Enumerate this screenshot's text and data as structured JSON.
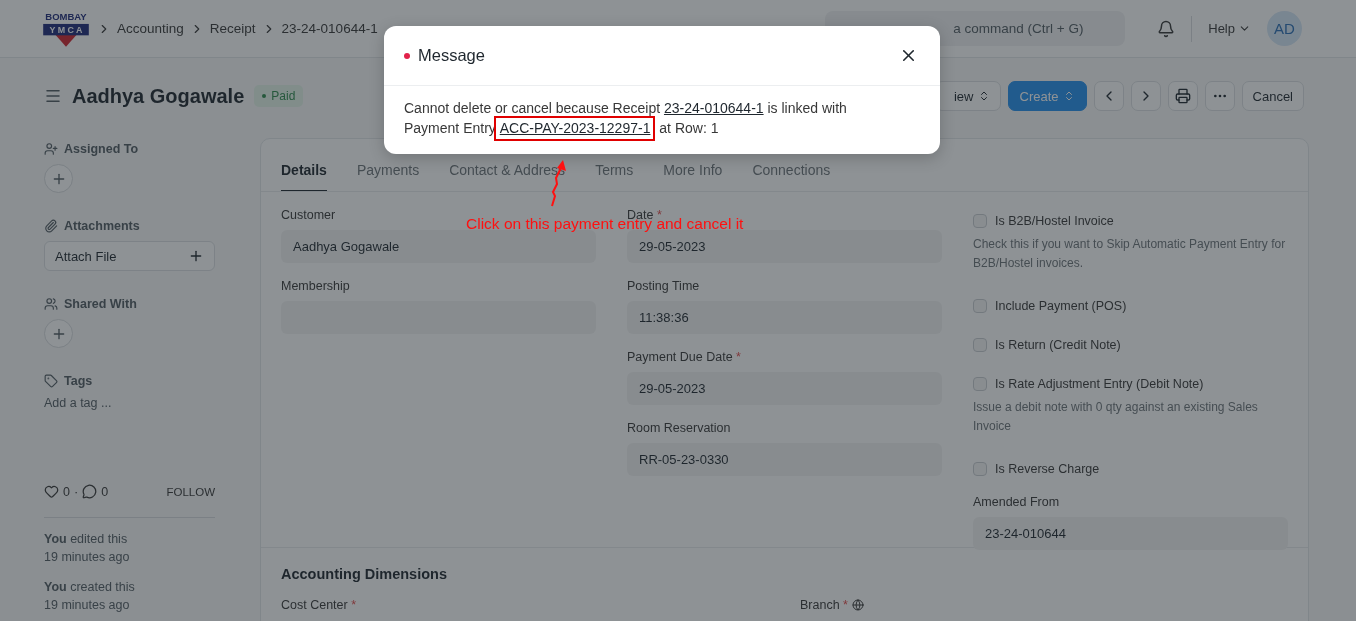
{
  "navbar": {
    "logo": {
      "top": "BOMBAY",
      "band": "Y M C A"
    },
    "breadcrumbs": [
      "Accounting",
      "Receipt",
      "23-24-010644-1"
    ],
    "search": {
      "placeholder": "a command (Ctrl + G)"
    },
    "help": "Help",
    "avatar": "AD"
  },
  "page_head": {
    "title": "Aadhya Gogawale",
    "status": "Paid",
    "buttons": [
      {
        "kind": "select",
        "label": "iew"
      },
      {
        "kind": "primary",
        "label": "Create"
      },
      {
        "kind": "prev"
      },
      {
        "kind": "next"
      },
      {
        "kind": "print"
      },
      {
        "kind": "more"
      },
      {
        "kind": "default",
        "label": "Cancel"
      }
    ]
  },
  "sidebar": {
    "sections": [
      {
        "kind": "assign",
        "title": "Assigned To"
      },
      {
        "kind": "attach",
        "title": "Attachments",
        "button": "Attach File"
      },
      {
        "kind": "share",
        "title": "Shared With"
      },
      {
        "kind": "tags",
        "title": "Tags",
        "placeholder": "Add a tag ..."
      }
    ],
    "likes": "0",
    "separator": "·",
    "comments": "0",
    "follow": "FOLLOW",
    "activity": [
      {
        "who": "You",
        "action": " edited this",
        "time": "19 minutes ago"
      },
      {
        "who": "You",
        "action": " created this",
        "time": "19 minutes ago"
      }
    ]
  },
  "tabs": [
    {
      "label": "Details",
      "selected": true
    },
    {
      "label": "Payments",
      "selected": false
    },
    {
      "label": "Contact & Address",
      "selected": false
    },
    {
      "label": "Terms",
      "selected": false
    },
    {
      "label": "More Info",
      "selected": false
    },
    {
      "label": "Connections",
      "selected": false
    }
  ],
  "columns": [
    [
      {
        "kind": "field",
        "label": "Customer",
        "required": false,
        "value": "Aadhya Gogawale"
      },
      {
        "kind": "field",
        "label": "Membership",
        "required": false
      }
    ],
    [
      {
        "kind": "field",
        "label": "Date",
        "required": true,
        "value": "29-05-2023"
      },
      {
        "kind": "field",
        "label": "Posting Time",
        "required": false,
        "value": "11:38:36"
      },
      {
        "kind": "field",
        "label": "Payment Due Date",
        "required": true,
        "value": "29-05-2023"
      },
      {
        "kind": "field",
        "label": "Room Reservation",
        "required": false,
        "value": "RR-05-23-0330"
      }
    ],
    [
      {
        "kind": "checkbox",
        "label": "Is B2B/Hostel Invoice",
        "checked": false
      },
      {
        "kind": "help",
        "text": "Check this if you want to Skip Automatic Payment Entry for B2B/Hostel invoices."
      },
      {
        "kind": "checkbox",
        "label": "Include Payment (POS)",
        "checked": false
      },
      {
        "kind": "checkbox",
        "label": "Is Return (Credit Note)",
        "checked": false
      },
      {
        "kind": "checkbox",
        "label": "Is Rate Adjustment Entry (Debit Note)",
        "checked": false
      },
      {
        "kind": "help",
        "text": "Issue a debit note with 0 qty against an existing Sales Invoice"
      },
      {
        "kind": "checkbox",
        "label": "Is Reverse Charge",
        "checked": false
      },
      {
        "kind": "field",
        "label": "Amended From",
        "required": false,
        "value": "23-24-010644"
      }
    ]
  ],
  "section": {
    "title": "Accounting Dimensions",
    "fields": [
      {
        "label": "Cost Center",
        "required": true,
        "info": false
      },
      {
        "label": "Branch",
        "required": true,
        "info": true
      }
    ]
  },
  "required_mark": "*",
  "modal": {
    "title": "Message",
    "before": "Cannot delete or cancel because Receipt ",
    "link1": "23-24-010644-1",
    "middle": " is linked with Payment Entry ",
    "link2": "ACC-PAY-2023-12297-1",
    "after": " at Row: 1"
  },
  "annotation": {
    "text": "Click on this payment entry and cancel it"
  }
}
